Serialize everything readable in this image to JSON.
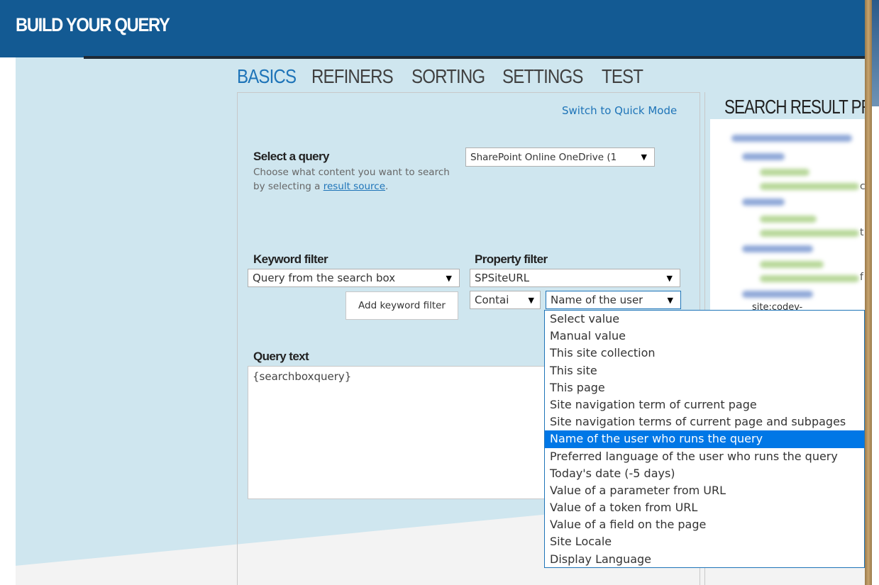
{
  "header": {
    "title": "BUILD YOUR QUERY"
  },
  "tabs": [
    {
      "label": "BASICS",
      "active": true
    },
    {
      "label": "REFINERS",
      "active": false
    },
    {
      "label": "SORTING",
      "active": false
    },
    {
      "label": "SETTINGS",
      "active": false
    },
    {
      "label": "TEST",
      "active": false
    }
  ],
  "basics": {
    "switch_mode_link": "Switch to Quick Mode",
    "select_query": {
      "label": "Select a query",
      "help_prefix": "Choose what content you want to search by selecting a ",
      "help_link": "result source",
      "help_suffix": ".",
      "value": "SharePoint Online OneDrive (1"
    },
    "keyword_filter": {
      "label": "Keyword filter",
      "value": "Query from the search box",
      "add_button": "Add keyword filter"
    },
    "property_filter": {
      "label": "Property filter",
      "property": "SPSiteURL",
      "operator": "Contai",
      "value": "Name of the user"
    },
    "query_text": {
      "label": "Query text",
      "value": "{searchboxquery}"
    }
  },
  "preview": {
    "title": "SEARCH RESULT PR",
    "edge_chars": [
      "c",
      "t",
      "f"
    ],
    "partial_text": "site:codev-"
  },
  "value_dropdown": {
    "options": [
      "Select value",
      "Manual value",
      "This site collection",
      "This site",
      "This page",
      "Site navigation term of current page",
      "Site navigation terms of current page and subpages",
      "Name of the user who runs the query",
      "Preferred language of the user who runs the query",
      "Today's date (-5 days)",
      "Value of a parameter from URL",
      "Value of a token from URL",
      "Value of a field on the page",
      "Site Locale",
      "Display Language"
    ],
    "selected_index": 7
  },
  "colors": {
    "header_bg": "#135a93",
    "accent": "#1e74b8",
    "panel_bg": "#cfe6ef",
    "selected_bg": "#0077e6"
  },
  "icons": {
    "dropdown_arrow": "triangle-down-icon"
  }
}
